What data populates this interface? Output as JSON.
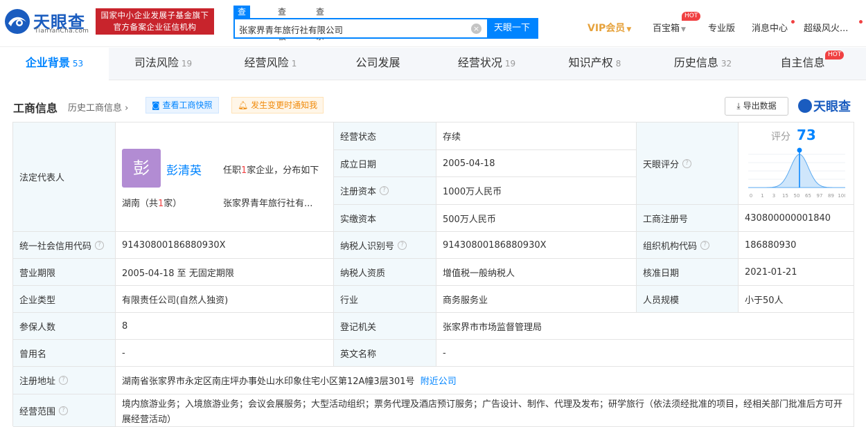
{
  "header": {
    "logo_cn": "天眼查",
    "logo_en": "TianYanCha.com",
    "badge_line1": "国家中小企业发展子基金旗下",
    "badge_line2": "官方备案企业征信机构",
    "search_tabs": [
      "查公司",
      "查老板",
      "查关系"
    ],
    "search_value": "张家界青年旅行社有限公司",
    "search_button": "天眼一下",
    "nav": {
      "vip": "VIP会员",
      "treasure": "百宝箱",
      "hot": "HOT",
      "pro": "专业版",
      "messages": "消息中心",
      "user": "超级风火..."
    }
  },
  "tabs": [
    {
      "label": "企业背景",
      "count": "53"
    },
    {
      "label": "司法风险",
      "count": "19"
    },
    {
      "label": "经营风险",
      "count": "1"
    },
    {
      "label": "公司发展",
      "count": ""
    },
    {
      "label": "经营状况",
      "count": "19"
    },
    {
      "label": "知识产权",
      "count": "8"
    },
    {
      "label": "历史信息",
      "count": "32"
    },
    {
      "label": "自主信息",
      "count": ""
    }
  ],
  "tab_hot": "HOT",
  "section": {
    "title": "工商信息",
    "history_link": "历史工商信息",
    "snapshot_btn": "查看工商快照",
    "notify_btn": "发生变更时通知我",
    "export_btn": "导出数据",
    "brand": "天眼查"
  },
  "legal_rep": {
    "label": "法定代表人",
    "avatar_char": "彭",
    "name": "彭清英",
    "info_pre": "任职",
    "info_num": "1",
    "info_post": "家企业，分布如下",
    "region_pre": "湖南（共",
    "region_num": "1",
    "region_post": "家）",
    "company": "张家界青年旅行社有..."
  },
  "score": {
    "label": "天眼评分",
    "caption": "评分",
    "value": "73",
    "axis": [
      "0",
      "1",
      "3",
      "15",
      "50",
      "65",
      "97",
      "89",
      "100"
    ]
  },
  "fields": {
    "status_label": "经营状态",
    "status_value": "存续",
    "founded_label": "成立日期",
    "founded_value": "2005-04-18",
    "reg_capital_label": "注册资本",
    "reg_capital_value": "1000万人民币",
    "paid_capital_label": "实缴资本",
    "paid_capital_value": "500万人民币",
    "reg_no_label": "工商注册号",
    "reg_no_value": "430800000001840",
    "credit_code_label": "统一社会信用代码",
    "credit_code_value": "91430800186880930X",
    "taxpayer_id_label": "纳税人识别号",
    "taxpayer_id_value": "91430800186880930X",
    "org_code_label": "组织机构代码",
    "org_code_value": "186880930",
    "term_label": "营业期限",
    "term_value": "2005-04-18 至 无固定期限",
    "taxpayer_type_label": "纳税人资质",
    "taxpayer_type_value": "增值税一般纳税人",
    "approve_label": "核准日期",
    "approve_value": "2021-01-21",
    "type_label": "企业类型",
    "type_value": "有限责任公司(自然人独资)",
    "industry_label": "行业",
    "industry_value": "商务服务业",
    "staff_label": "人员规模",
    "staff_value": "小于50人",
    "insured_label": "参保人数",
    "insured_value": "8",
    "authority_label": "登记机关",
    "authority_value": "张家界市市场监督管理局",
    "former_label": "曾用名",
    "former_value": "-",
    "en_name_label": "英文名称",
    "en_name_value": "-",
    "address_label": "注册地址",
    "address_value": "湖南省张家界市永定区南庄坪办事处山水印象住宅小区第12A幢3层301号",
    "nearby_link": "附近公司",
    "scope_label": "经营范围",
    "scope_value": "境内旅游业务；入境旅游业务；会议会展服务；大型活动组织；票务代理及酒店预订服务；广告设计、制作、代理及发布；研学旅行（依法须经批准的项目，经相关部门批准后方可开展经营活动）"
  },
  "colors": {
    "brand_blue": "#0084ff",
    "badge_red": "#c8242c",
    "label_bg": "#f2f9fc",
    "avatar": "#b28cd3"
  }
}
